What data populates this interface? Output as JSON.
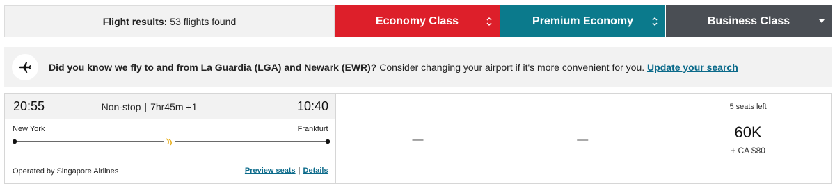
{
  "header": {
    "results_label": "Flight results:",
    "results_count": "53 flights found",
    "tabs": [
      {
        "label": "Economy Class",
        "color": "#dd1f2a"
      },
      {
        "label": "Premium Economy",
        "color": "#0b7a8c"
      },
      {
        "label": "Business Class",
        "color": "#4a4e54"
      }
    ]
  },
  "banner": {
    "icon": "airplane-icon",
    "strong_text": "Did you know we fly to and from La Guardia (LGA) and Newark (EWR)?",
    "text": " Consider changing your airport if it's more convenient for you. ",
    "link_text": "Update your search",
    "link_color": "#0b6a8a"
  },
  "flight": {
    "departure_time": "20:55",
    "arrival_time": "10:40",
    "stops": "Non-stop",
    "duration": "7hr45m +1",
    "origin": "New York",
    "destination": "Frankfurt",
    "operated_by": "Operated by Singapore Airlines",
    "preview_seats_label": "Preview seats",
    "details_label": "Details",
    "fares": {
      "economy": "—",
      "premium_economy": "—",
      "business": {
        "seats_left": "5 seats left",
        "points": "60K",
        "fee": "+ CA $80"
      }
    }
  }
}
